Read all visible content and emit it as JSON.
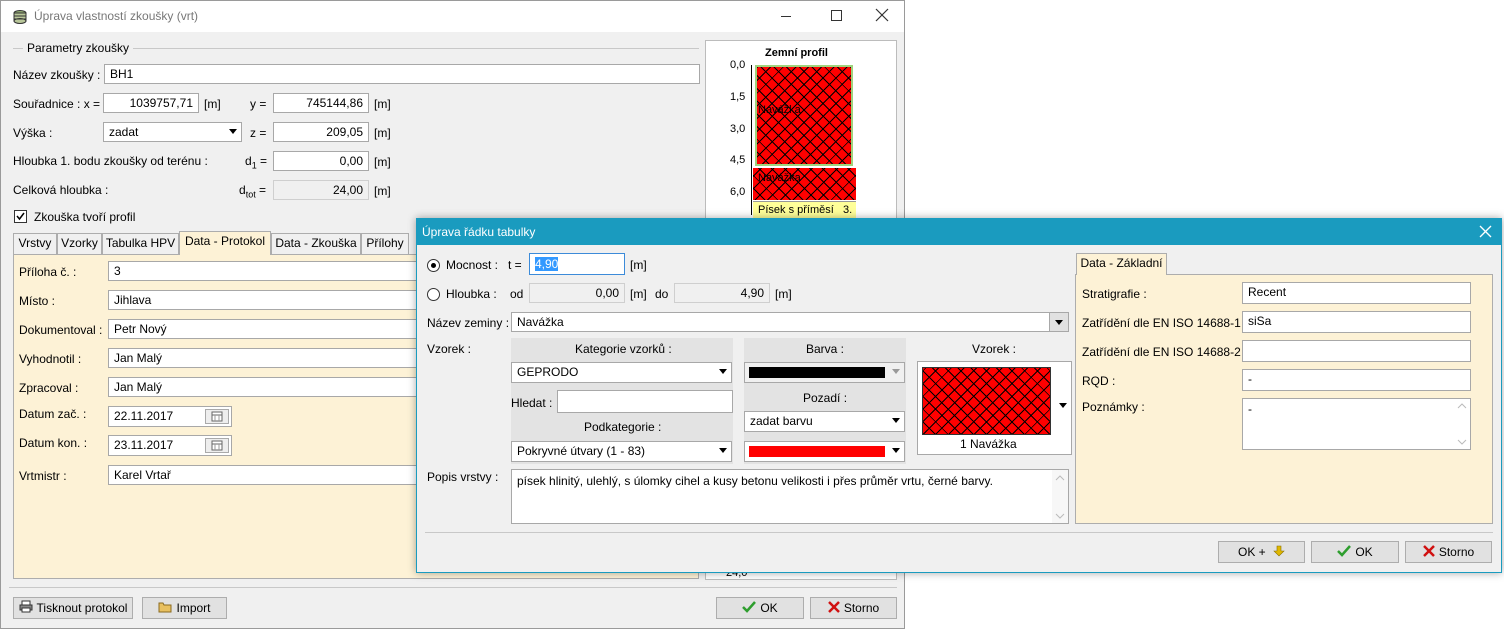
{
  "main": {
    "title": "Úprava vlastností zkoušky (vrt)",
    "params_label": "Parametry zkoušky",
    "name_label": "Název zkoušky :",
    "name_value": "BH1",
    "coords_label": "Souřadnice : x =",
    "x_value": "1039757,71",
    "unit_m": "[m]",
    "y_label": "y =",
    "y_value": "745144,86",
    "height_label": "Výška :",
    "height_mode": "zadat",
    "z_label": "z =",
    "z_value": "209,05",
    "depth1_label": "Hloubka 1. bodu zkoušky od terénu :",
    "d1_label": "d",
    "d1_sub": "1",
    "d1_eq": " =",
    "d1_value": "0,00",
    "total_label": "Celková hloubka :",
    "dtot_label": "d",
    "dtot_sub": "tot",
    "dtot_eq": " =",
    "dtot_value": "24,00",
    "profile_check_label": "Zkouška tvoří profil",
    "tabs": [
      "Vrstvy",
      "Vzorky",
      "Tabulka HPV",
      "Data - Protokol",
      "Data - Zkouška",
      "Přílohy"
    ],
    "protocol": {
      "priloha_label": "Příloha č. :",
      "priloha_value": "3",
      "misto_label": "Místo :",
      "misto_value": "Jihlava",
      "dok_label": "Dokumentoval :",
      "dok_value": "Petr Nový",
      "vyh_label": "Vyhodnotil :",
      "vyh_value": "Jan Malý",
      "zpr_label": "Zpracoval :",
      "zpr_value": "Jan Malý",
      "zac_label": "Datum zač. :",
      "zac_value": "22.11.2017",
      "kon_label": "Datum kon. :",
      "kon_value": "23.11.2017",
      "vrt_label": "Vrtmistr :",
      "vrt_value": "Karel Vrtař"
    },
    "print_button": "Tisknout protokol",
    "import_button": "Import",
    "ok_button": "OK",
    "cancel_button": "Storno"
  },
  "profile": {
    "title": "Zemní profil",
    "ticks": [
      "0,0",
      "1,5",
      "3,0",
      "4,5",
      "6,0"
    ],
    "layer1": "Navážka",
    "layer2": "Navážka",
    "layer3": "Písek s příměsí",
    "layer3_num": "3.",
    "bottom_value": "24,0"
  },
  "dialog": {
    "title": "Úprava řádku tabulky",
    "thickness_label": "Mocnost :",
    "t_label": "t =",
    "t_value": "4,90",
    "unit_m": "[m]",
    "depth_label": "Hloubka :",
    "od_label": "od",
    "od_value": "0,00",
    "do_label": "do",
    "do_value": "4,90",
    "soil_name_label": "Název zeminy :",
    "soil_name_value": "Navážka",
    "sample_label": "Vzorek :",
    "category_header": "Kategorie vzorků :",
    "category_value": "GEPRODO",
    "search_label": "Hledat :",
    "subcategory_header": "Podkategorie :",
    "subcategory_value": "Pokryvné útvary (1 - 83)",
    "color_header": "Barva :",
    "background_header": "Pozadí :",
    "background_value": "zadat barvu",
    "pattern_header": "Vzorek :",
    "pattern_caption": "1 Navážka",
    "description_label": "Popis vrstvy :",
    "description_value": "písek hlinitý, ulehlý, s úlomky cihel a kusy betonu velikosti i přes průměr vrtu, černé barvy.",
    "right_tab": "Data - Základní",
    "strat_label": "Stratigrafie :",
    "strat_value": "Recent",
    "iso1_label": "Zatřídění dle EN ISO 14688-1 :",
    "iso1_value": "siSa",
    "iso2_label": "Zatřídění dle EN ISO 14688-2 :",
    "iso2_value": "",
    "rqd_label": "RQD :",
    "rqd_value": "-",
    "notes_label": "Poznámky :",
    "notes_value": "-",
    "okplus_button": "OK +",
    "ok_button": "OK",
    "cancel_button": "Storno"
  },
  "colors": {
    "dialog_title_bar": "#1a9bbf",
    "panel_bg": "#fdf2d6",
    "layer_red": "#ff0000",
    "layer_yellow": "#ffff99",
    "ok_check": "#2e9e2e",
    "cancel_x": "#d01010"
  }
}
